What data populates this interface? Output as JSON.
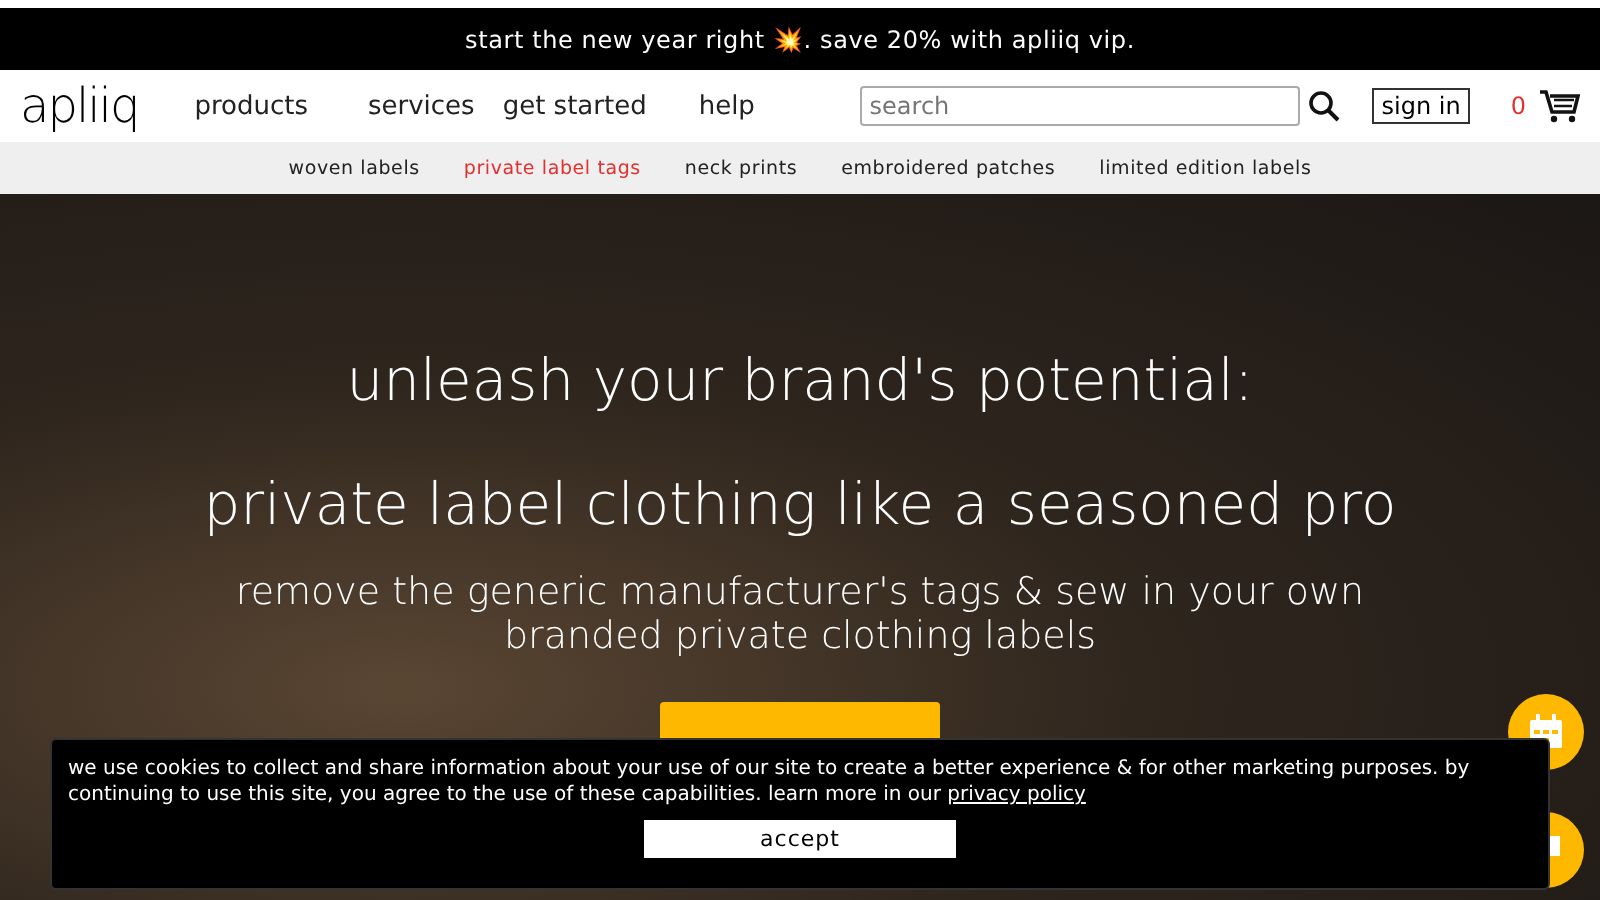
{
  "announcement": {
    "text": "start the new year right 💥. save 20% with apliiq vip."
  },
  "header": {
    "logo": "apliiq",
    "nav": [
      "products",
      "services",
      "get started",
      "help"
    ],
    "search": {
      "placeholder": "search"
    },
    "sign_in": "sign in",
    "cart_count": "0"
  },
  "subnav": [
    {
      "label": "woven labels",
      "selected": false
    },
    {
      "label": "private label tags",
      "selected": true
    },
    {
      "label": "neck prints",
      "selected": false
    },
    {
      "label": "embroidered patches",
      "selected": false
    },
    {
      "label": "limited edition labels",
      "selected": false
    }
  ],
  "hero": {
    "title_1": "unleash your brand's potential:",
    "title_2": "private label clothing like a seasoned pro",
    "subtitle": "remove the generic manufacturer's tags & sew in your own branded private clothing labels"
  },
  "cookie_banner": {
    "text": "we use cookies to collect and share information about your use of our site to create a better experience & for other marketing purposes. by continuing to use this site, you agree to the use of these capabilities. learn more in our",
    "link": "privacy policy",
    "button": "accept"
  }
}
